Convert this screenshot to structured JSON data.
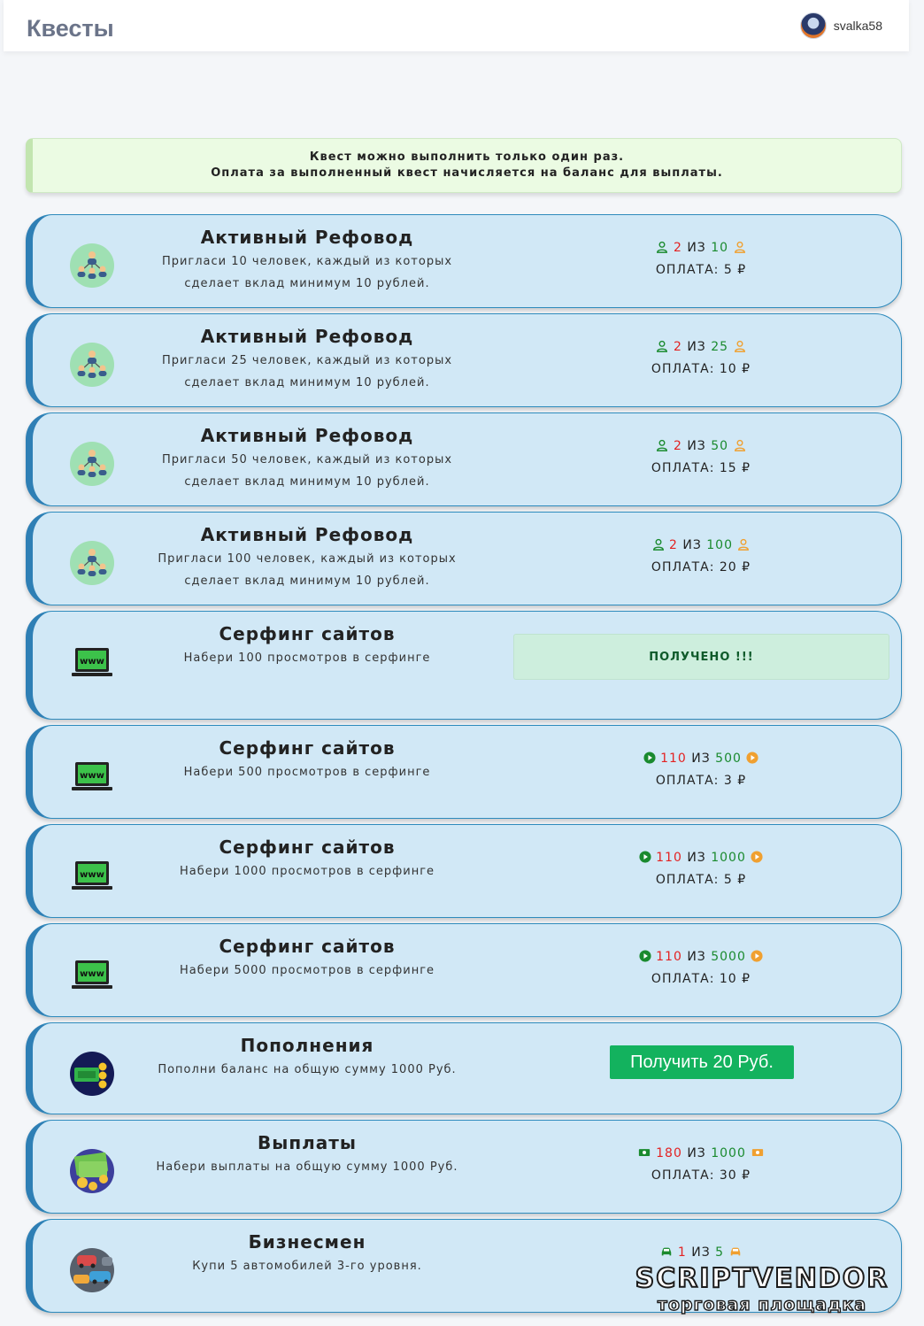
{
  "header": {
    "title": "Квесты",
    "username": "svalka58"
  },
  "notice": {
    "line1": "Квест можно выполнить только один раз.",
    "line2": "Оплата за выполненный квест начисляется на баланс для выплаты."
  },
  "labels": {
    "of": "ИЗ",
    "pay": "ОПЛАТА:",
    "currency": "₽"
  },
  "quests": [
    {
      "title": "Активный Рефовод",
      "desc1": "Пригласи 10 человек, каждый из которых",
      "desc2": "сделает вклад минимум 10 рублей.",
      "current": "2",
      "target": "10",
      "pay": "5"
    },
    {
      "title": "Активный Рефовод",
      "desc1": "Пригласи 25 человек, каждый из которых",
      "desc2": "сделает вклад минимум 10 рублей.",
      "current": "2",
      "target": "25",
      "pay": "10"
    },
    {
      "title": "Активный Рефовод",
      "desc1": "Пригласи 50 человек, каждый из которых",
      "desc2": "сделает вклад минимум 10 рублей.",
      "current": "2",
      "target": "50",
      "pay": "15"
    },
    {
      "title": "Активный Рефовод",
      "desc1": "Пригласи 100 человек, каждый из которых",
      "desc2": "сделает вклад минимум 10 рублей.",
      "current": "2",
      "target": "100",
      "pay": "20"
    },
    {
      "title": "Серфинг сайтов",
      "desc1": "Набери 100 просмотров в серфинге",
      "status": "ПОЛУЧЕНО !!!"
    },
    {
      "title": "Серфинг сайтов",
      "desc1": "Набери 500 просмотров в серфинге",
      "current": "110",
      "target": "500",
      "pay": "3"
    },
    {
      "title": "Серфинг сайтов",
      "desc1": "Набери 1000 просмотров в серфинге",
      "current": "110",
      "target": "1000",
      "pay": "5"
    },
    {
      "title": "Серфинг сайтов",
      "desc1": "Набери 5000 просмотров в серфинге",
      "current": "110",
      "target": "5000",
      "pay": "10"
    },
    {
      "title": "Пополнения",
      "desc1": "Пополни баланс на общую сумму 1000 Руб.",
      "button": "Получить 20 Руб."
    },
    {
      "title": "Выплаты",
      "desc1": "Набери выплаты на общую сумму 1000 Руб.",
      "current": "180",
      "target": "1000",
      "pay": "30"
    },
    {
      "title": "Бизнесмен",
      "desc1": "Купи 5 автомобилей 3-го уровня.",
      "current": "1",
      "target": "5"
    }
  ],
  "watermark": {
    "main": "SCRIPTVENDOR",
    "sub": "торговая площадка"
  },
  "colors": {
    "card_bg": "#d1e8f6",
    "card_border": "#2e7fb5",
    "current": "#e32222",
    "target": "#1a8a2e",
    "button": "#13b25e"
  }
}
